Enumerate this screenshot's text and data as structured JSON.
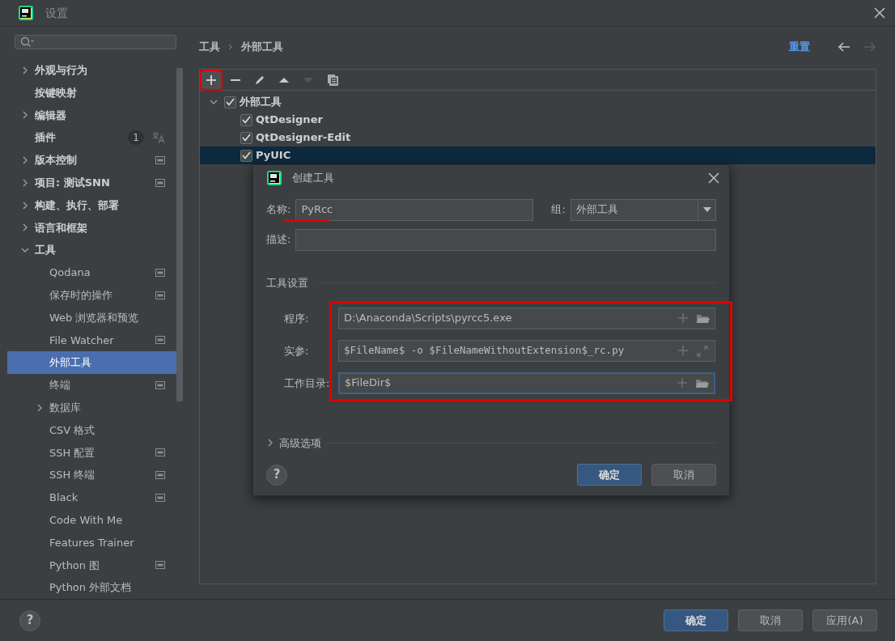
{
  "window": {
    "title": "设置"
  },
  "sidebar": {
    "items": [
      {
        "label": "外观与行为",
        "expanded": false,
        "selected": false
      },
      {
        "label": "按键映射",
        "selected": false
      },
      {
        "label": "编辑器",
        "expanded": false,
        "selected": false
      },
      {
        "label": "插件",
        "selected": false,
        "badge": "1",
        "translate_icon": true
      },
      {
        "label": "版本控制",
        "expanded": false,
        "selected": false,
        "project_icon": true
      },
      {
        "label": "项目: 测试SNN",
        "expanded": false,
        "selected": false,
        "project_icon": true
      },
      {
        "label": "构建、执行、部署",
        "expanded": false,
        "selected": false
      },
      {
        "label": "语言和框架",
        "expanded": false,
        "selected": false
      },
      {
        "label": "工具",
        "expanded": true,
        "selected": false,
        "children": [
          {
            "label": "Qodana",
            "selected": false,
            "project_icon": true
          },
          {
            "label": "保存时的操作",
            "selected": false,
            "project_icon": true
          },
          {
            "label": "Web 浏览器和预览",
            "selected": false
          },
          {
            "label": "File Watcher",
            "selected": false,
            "project_icon": true
          },
          {
            "label": "外部工具",
            "selected": true
          },
          {
            "label": "终端",
            "selected": false,
            "project_icon": true
          },
          {
            "label": "数据库",
            "expanded": false,
            "selected": false
          },
          {
            "label": "CSV 格式",
            "selected": false
          },
          {
            "label": "SSH 配置",
            "selected": false,
            "project_icon": true
          },
          {
            "label": "SSH 终端",
            "selected": false,
            "project_icon": true
          },
          {
            "label": "Black",
            "selected": false,
            "project_icon": true
          },
          {
            "label": "Code With Me",
            "selected": false
          },
          {
            "label": "Features Trainer",
            "selected": false
          },
          {
            "label": "Python 图",
            "selected": false,
            "project_icon": true
          },
          {
            "label": "Python 外部文档",
            "selected": false
          }
        ]
      }
    ]
  },
  "breadcrumb": [
    "工具",
    "外部工具"
  ],
  "reset_link": "重置",
  "nav": [
    {
      "kind": "back",
      "disabled": false
    },
    {
      "kind": "forward",
      "disabled": true
    }
  ],
  "toolbar": [
    {
      "kind": "add",
      "disabled": false,
      "highlighted": true
    },
    {
      "kind": "remove",
      "disabled": false,
      "highlighted": false
    },
    {
      "kind": "edit",
      "disabled": false,
      "highlighted": false
    },
    {
      "kind": "up",
      "disabled": false,
      "highlighted": false
    },
    {
      "kind": "down",
      "disabled": true,
      "highlighted": false
    },
    {
      "kind": "copy",
      "disabled": false,
      "highlighted": false
    }
  ],
  "tree": [
    {
      "label": "外部工具",
      "checked": true,
      "expanded": true,
      "selected": false,
      "children": [
        {
          "label": "QtDesigner",
          "checked": true,
          "selected": false
        },
        {
          "label": "QtDesigner-Edit",
          "checked": true,
          "selected": false
        },
        {
          "label": "PyUIC",
          "checked": true,
          "selected": true
        }
      ]
    }
  ],
  "dialog": {
    "title": "创建工具",
    "name": {
      "label": "名称:",
      "value": "PyRcc",
      "underlined": true
    },
    "group": {
      "label": "组:",
      "value": "外部工具"
    },
    "description": {
      "label": "描述:"
    },
    "tool_settings": {
      "title": "工具设置",
      "highlighted": true,
      "fields": [
        {
          "label": "程序:",
          "value": "D:\\Anaconda\\Scripts\\pyrcc5.exe",
          "kind": "file",
          "monospace": false,
          "focused": false
        },
        {
          "label": "实参:",
          "value": "$FileName$ -o $FileNameWithoutExtension$_rc.py",
          "kind": "expand",
          "monospace": true,
          "focused": false
        },
        {
          "label": "工作目录:",
          "value": "$FileDir$",
          "kind": "file",
          "monospace": false,
          "focused": true
        }
      ]
    },
    "advanced": {
      "label": "高级选项",
      "expanded": false
    },
    "help": "?",
    "buttons": [
      {
        "label": "确定",
        "primary": true
      },
      {
        "label": "取消",
        "primary": false
      }
    ]
  },
  "footer_help": "?",
  "footer_buttons": [
    {
      "label": "确定",
      "primary": true
    },
    {
      "label": "取消",
      "primary": false
    },
    {
      "label": "应用(A)",
      "primary": false
    }
  ]
}
